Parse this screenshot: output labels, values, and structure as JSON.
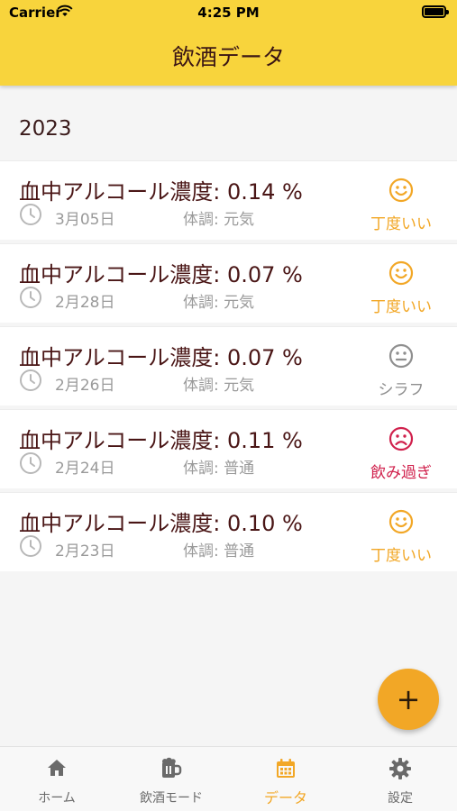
{
  "status": {
    "carrier": "Carrier",
    "time": "4:25 PM"
  },
  "header": {
    "title": "飲酒データ"
  },
  "year": "2023",
  "records": [
    {
      "title": "血中アルコール濃度: 0.14 %",
      "date": "3月05日",
      "condition": "体調: 元気",
      "mood": "丁度いい",
      "mood_icon": "smile-icon",
      "mood_color": "#f2a726"
    },
    {
      "title": "血中アルコール濃度: 0.07 %",
      "date": "2月28日",
      "condition": "体調: 元気",
      "mood": "丁度いい",
      "mood_icon": "smile-icon",
      "mood_color": "#f2a726"
    },
    {
      "title": "血中アルコール濃度: 0.07 %",
      "date": "2月26日",
      "condition": "体調: 元気",
      "mood": "シラフ",
      "mood_icon": "neutral-face-icon",
      "mood_color": "#8f8f8f"
    },
    {
      "title": "血中アルコール濃度: 0.11 %",
      "date": "2月24日",
      "condition": "体調: 普通",
      "mood": "飲み過ぎ",
      "mood_icon": "frown-icon",
      "mood_color": "#d0204c"
    },
    {
      "title": "血中アルコール濃度: 0.10 %",
      "date": "2月23日",
      "condition": "体調: 普通",
      "mood": "丁度いい",
      "mood_icon": "smile-icon",
      "mood_color": "#f2a726"
    }
  ],
  "fab": {
    "label": "+"
  },
  "tabs": [
    {
      "label": "ホーム",
      "icon": "home-icon"
    },
    {
      "label": "飲酒モード",
      "icon": "beer-mug-icon"
    },
    {
      "label": "データ",
      "icon": "calendar-icon",
      "active": true
    },
    {
      "label": "設定",
      "icon": "gear-icon"
    }
  ],
  "colors": {
    "header": "#f8d43c",
    "accent": "#f2a726",
    "danger": "#d0204c"
  }
}
